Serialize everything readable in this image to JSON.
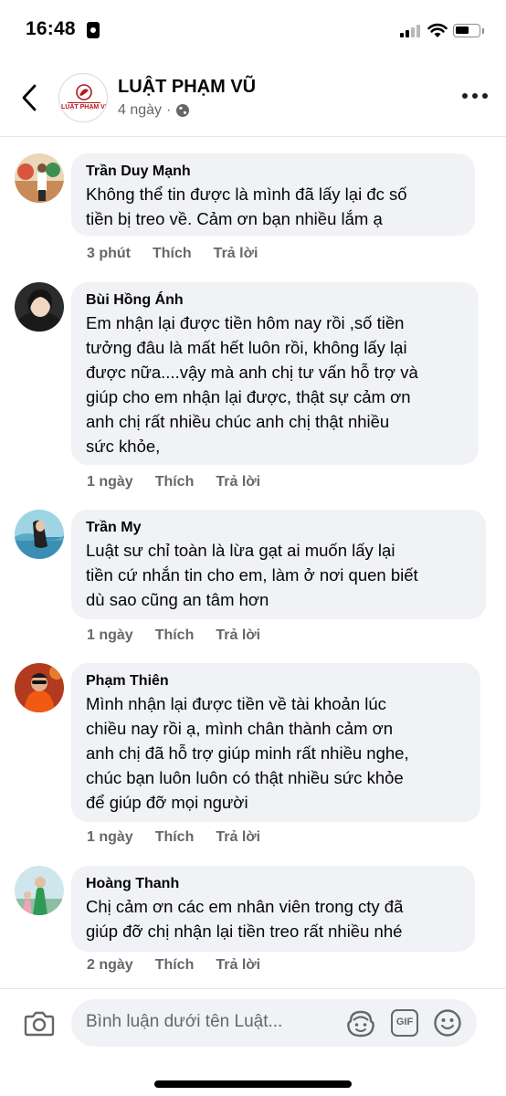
{
  "status_bar": {
    "time": "16:48"
  },
  "header": {
    "page_name": "LUẬT PHẠM VŨ",
    "post_age": "4 ngày",
    "separator": "·",
    "logo_text": "LUẬT PHẠM VŨ",
    "icons": [
      "back-arrow-icon",
      "globe-icon",
      "more-icon"
    ]
  },
  "comments": [
    {
      "author": "Trần Duy Mạnh",
      "text": "Không thể tin được là mình đã lấy lại đc số\ntiền bị treo về. Cảm ơn bạn nhiều lắm ạ",
      "time": "3 phút",
      "like": "Thích",
      "reply": "Trả lời"
    },
    {
      "author": "Bùi Hồng Ánh",
      "text": "Em nhận lại được tiền hôm nay rồi ,số tiền\ntưởng đâu là mất hết luôn rồi, không lấy lại\nđược nữa....vậy mà anh chị tư vấn hỗ trợ và\ngiúp cho em nhận lại được, thật sự cảm ơn\nanh chị rất nhiều chúc anh chị thật nhiều\nsức khỏe,",
      "time": "1 ngày",
      "like": "Thích",
      "reply": "Trả lời"
    },
    {
      "author": "Trần My",
      "text": "Luật sư chỉ toàn là lừa gạt ai muốn lấy lại\ntiền cứ nhắn tin cho em, làm ở nơi quen biết\ndù sao cũng an tâm hơn",
      "time": "1 ngày",
      "like": "Thích",
      "reply": "Trả lời"
    },
    {
      "author": "Phạm Thiên",
      "text": "Mình nhận lại được tiền về tài khoản lúc\nchiều nay rồi ạ, mình chân thành cảm ơn\nanh chị đã hỗ trợ giúp minh rất nhiều nghe,\nchúc bạn luôn luôn có thật nhiều sức khỏe\nđể giúp đỡ mọi người",
      "time": "1 ngày",
      "like": "Thích",
      "reply": "Trả lời"
    },
    {
      "author": "Hoàng Thanh",
      "text": "Chị cảm ơn các em nhân viên trong cty đã\ngiúp đỡ chị nhận lại tiền treo rất nhiều nhé",
      "time": "2 ngày",
      "like": "Thích",
      "reply": "Trả lời"
    }
  ],
  "composer": {
    "placeholder": "Bình luận dưới tên Luật...",
    "gif_label": "GIF",
    "icons": [
      "camera-icon",
      "avatar-sticker-icon",
      "gif-icon",
      "emoji-icon"
    ]
  },
  "colors": {
    "bubble": "#f0f2f5",
    "secondary_text": "#65676b",
    "logo_red": "#b3171d"
  }
}
